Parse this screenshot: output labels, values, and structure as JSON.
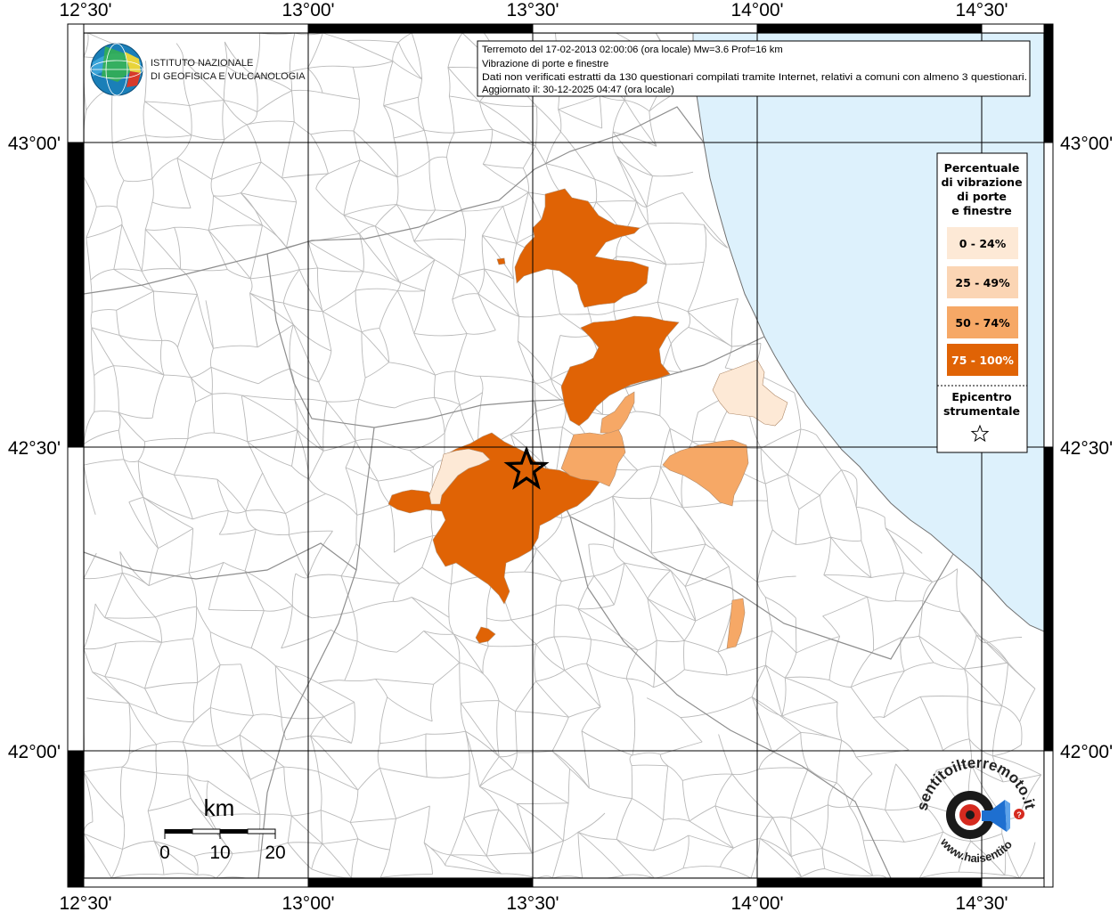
{
  "map": {
    "top_labels": [
      "12°30'",
      "13°00'",
      "13°30'",
      "14°00'",
      "14°30'"
    ],
    "bottom_labels": [
      "12°30'",
      "13°00'",
      "13°30'",
      "14°00'",
      "14°30'"
    ],
    "left_labels": [
      "43°00'",
      "42°30'",
      "42°00'"
    ],
    "right_labels": [
      "43°00'",
      "42°30'",
      "42°00'"
    ]
  },
  "title_box": {
    "line1": "Terremoto del 17-02-2013 02:00:06 (ora locale) Mw=3.6 Prof=16 km",
    "line2": "Vibrazione di porte e finestre",
    "line3": "Dati non verificati estratti da 130 questionari compilati tramite Internet, relativi a comuni con almeno 3 questionari.",
    "line4": "Aggiornato il: 30-12-2025 04:47 (ora locale)"
  },
  "logo": {
    "line1": "ISTITUTO NAZIONALE",
    "line2": "DI GEOFISICA E VULCANOLOGIA"
  },
  "legend": {
    "title_lines": [
      "Percentuale",
      "di vibrazione",
      "di porte",
      "e finestre"
    ],
    "classes": [
      {
        "label": "0 - 24%",
        "color": "#FDE9D6"
      },
      {
        "label": "25 - 49%",
        "color": "#FBD5B4"
      },
      {
        "label": "50 - 74%",
        "color": "#F6A866"
      },
      {
        "label": "75 - 100%",
        "color": "#E06305"
      }
    ],
    "epicenter_lines": [
      "Epicentro",
      "strumentale"
    ]
  },
  "scale_bar": {
    "unit": "km",
    "ticks": [
      "0",
      "10",
      "20"
    ]
  },
  "badge": {
    "text_top": "sentitoilterremoto.it",
    "text_bottom": "www.haisentito"
  },
  "colors": {
    "sea": "#DDF1FC",
    "border": "#b7b7b7",
    "grid": "#000000"
  }
}
